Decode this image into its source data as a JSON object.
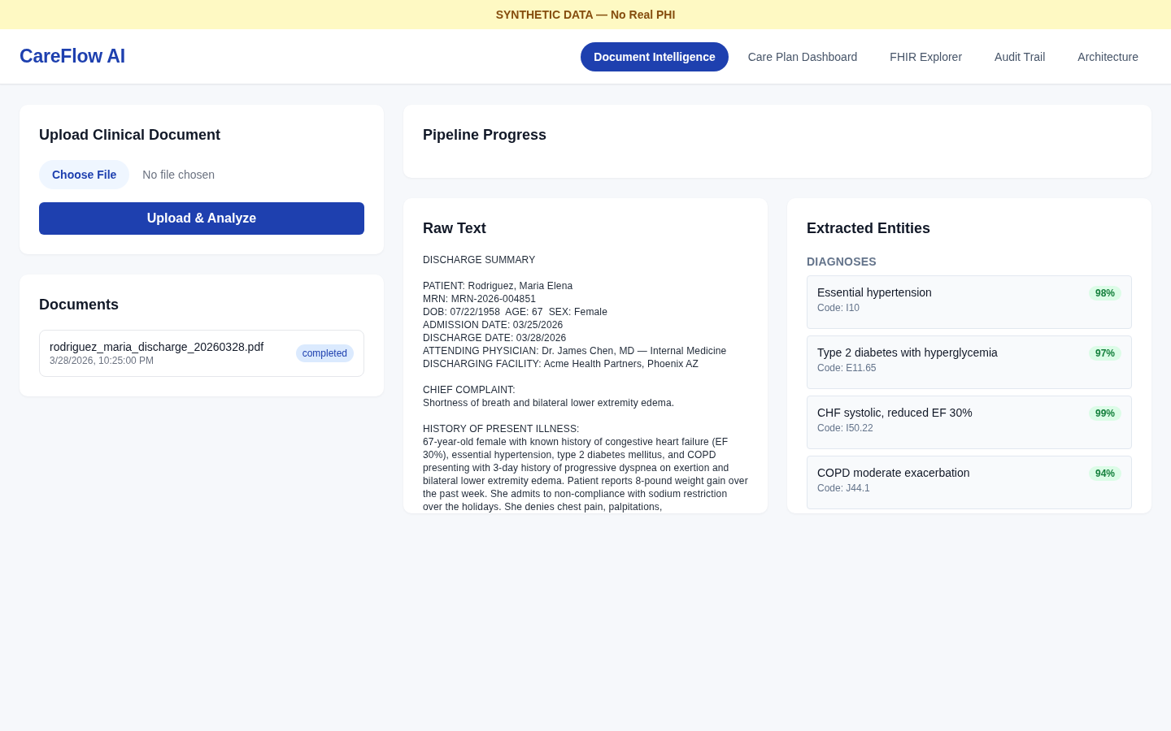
{
  "banner": {
    "text": "SYNTHETIC DATA — No Real PHI"
  },
  "header": {
    "logo": "CareFlow AI",
    "tabs": [
      {
        "label": "Document Intelligence",
        "selected": true
      },
      {
        "label": "Care Plan Dashboard",
        "selected": false
      },
      {
        "label": "FHIR Explorer",
        "selected": false
      },
      {
        "label": "Audit Trail",
        "selected": false
      },
      {
        "label": "Architecture",
        "selected": false
      }
    ]
  },
  "upload": {
    "title": "Upload Clinical Document",
    "choose_button": "Choose File",
    "file_status": "No file chosen",
    "submit_button": "Upload & Analyze"
  },
  "documents": {
    "title": "Documents",
    "items": [
      {
        "name": "rodriguez_maria_discharge_20260328.pdf",
        "date": "3/28/2026, 10:25:00 PM",
        "status": "completed"
      }
    ]
  },
  "pipeline": {
    "title": "Pipeline Progress"
  },
  "raw_text": {
    "title": "Raw Text",
    "text": "DISCHARGE SUMMARY\n\nPATIENT: Rodriguez, Maria Elena\nMRN: MRN-2026-004851\nDOB: 07/22/1958  AGE: 67  SEX: Female\nADMISSION DATE: 03/25/2026\nDISCHARGE DATE: 03/28/2026\nATTENDING PHYSICIAN: Dr. James Chen, MD — Internal Medicine\nDISCHARGING FACILITY: Acme Health Partners, Phoenix AZ\n\nCHIEF COMPLAINT:\nShortness of breath and bilateral lower extremity edema.\n\nHISTORY OF PRESENT ILLNESS:\n67-year-old female with known history of congestive heart failure (EF 30%), essential hypertension, type 2 diabetes mellitus, and COPD presenting with 3-day history of progressive dyspnea on exertion and bilateral lower extremity edema. Patient reports 8-pound weight gain over the past week. She admits to non-compliance with sodium restriction over the holidays. She denies chest pain, palpitations,"
  },
  "entities": {
    "title": "Extracted Entities",
    "section": "DIAGNOSES",
    "items": [
      {
        "name": "Essential hypertension",
        "code": "Code: I10",
        "confidence": "98%"
      },
      {
        "name": "Type 2 diabetes with hyperglycemia",
        "code": "Code: E11.65",
        "confidence": "97%"
      },
      {
        "name": "CHF systolic, reduced EF 30%",
        "code": "Code: I50.22",
        "confidence": "99%"
      },
      {
        "name": "COPD moderate exacerbation",
        "code": "Code: J44.1",
        "confidence": "94%"
      }
    ]
  }
}
